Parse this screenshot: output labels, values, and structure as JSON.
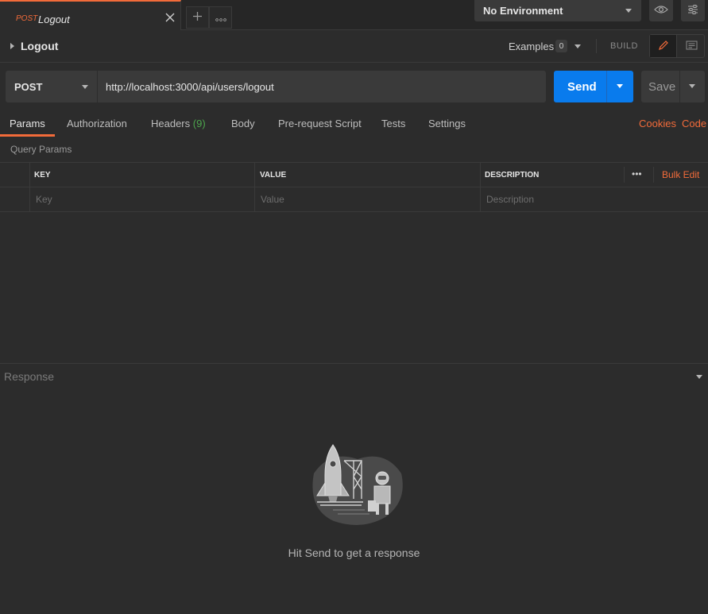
{
  "tab": {
    "method": "POST",
    "name": "Logout"
  },
  "environment": {
    "selected": "No Environment"
  },
  "header": {
    "title": "Logout",
    "examples_label": "Examples",
    "examples_count": "0",
    "build_label": "BUILD"
  },
  "request": {
    "method": "POST",
    "url": "http://localhost:3000/api/users/logout",
    "send_label": "Send",
    "save_label": "Save"
  },
  "subtabs": {
    "params": "Params",
    "authorization": "Authorization",
    "headers": "Headers",
    "headers_count": "(9)",
    "body": "Body",
    "prerequest": "Pre-request Script",
    "tests": "Tests",
    "settings": "Settings",
    "cookies": "Cookies",
    "code": "Code"
  },
  "query_params": {
    "label": "Query Params",
    "columns": {
      "key": "KEY",
      "value": "VALUE",
      "description": "DESCRIPTION"
    },
    "bulk_edit": "Bulk Edit",
    "more": "•••",
    "placeholders": {
      "key": "Key",
      "value": "Value",
      "description": "Description"
    }
  },
  "response": {
    "label": "Response",
    "hint": "Hit Send to get a response"
  },
  "colors": {
    "accent": "#f26b3a",
    "send": "#097bed",
    "count": "#4da64d"
  },
  "icons": [
    "close-icon",
    "plus-icon",
    "more-icon",
    "eye-icon",
    "sliders-icon",
    "pencil-icon",
    "document-icon",
    "chevron-down-icon",
    "chevron-right-icon"
  ]
}
